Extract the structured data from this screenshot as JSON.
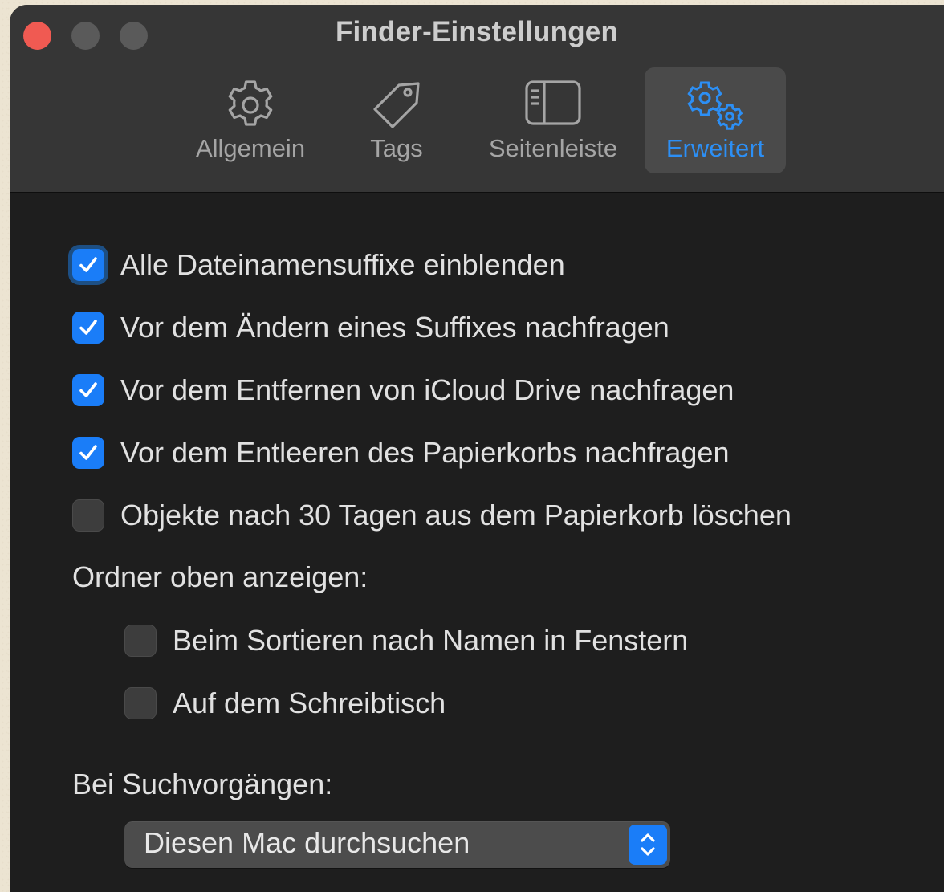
{
  "window": {
    "title": "Finder-Einstellungen"
  },
  "tabs": [
    {
      "label": "Allgemein",
      "icon": "gear-icon",
      "active": false
    },
    {
      "label": "Tags",
      "icon": "tag-icon",
      "active": false
    },
    {
      "label": "Seitenleiste",
      "icon": "sidebar-icon",
      "active": false
    },
    {
      "label": "Erweitert",
      "icon": "gears-icon",
      "active": true
    }
  ],
  "options": [
    {
      "label": "Alle Dateinamensuffixe einblenden",
      "checked": true
    },
    {
      "label": "Vor dem Ändern eines Suffixes nachfragen",
      "checked": true
    },
    {
      "label": "Vor dem Entfernen von iCloud Drive nachfragen",
      "checked": true
    },
    {
      "label": "Vor dem Entleeren des Papierkorbs nachfragen",
      "checked": true
    },
    {
      "label": "Objekte nach 30 Tagen aus dem Papierkorb löschen",
      "checked": false
    }
  ],
  "folders_on_top": {
    "label": "Ordner oben anzeigen:",
    "options": [
      {
        "label": "Beim Sortieren nach Namen in Fenstern",
        "checked": false
      },
      {
        "label": "Auf dem Schreibtisch",
        "checked": false
      }
    ]
  },
  "search": {
    "label": "Bei Suchvorgängen:",
    "selected": "Diesen Mac durchsuchen"
  },
  "colors": {
    "accent": "#1a7df8",
    "active_tab_text": "#2c8ff5",
    "close_button": "#f05a52"
  }
}
